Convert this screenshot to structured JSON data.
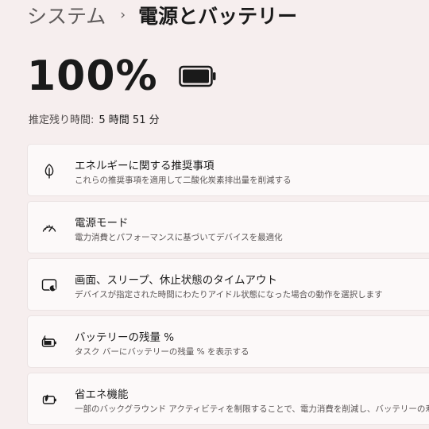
{
  "breadcrumb": {
    "parent": "システム",
    "separator": "›",
    "current": "電源とバッテリー"
  },
  "battery": {
    "percent_text": "100%",
    "charge_level": 1.0,
    "icon": "battery-full-icon",
    "remaining_label": "推定残り時間:",
    "remaining_value": "5 時間 51 分"
  },
  "settings": [
    {
      "icon": "leaf-icon",
      "title": "エネルギーに関する推奨事項",
      "description": "これらの推奨事項を適用して二酸化炭素排出量を削減する"
    },
    {
      "icon": "gauge-icon",
      "title": "電源モード",
      "description": "電力消費とパフォーマンスに基づいてデバイスを最適化"
    },
    {
      "icon": "screen-sleep-icon",
      "title": "画面、スリープ、休止状態のタイムアウト",
      "description": "デバイスが指定された時間にわたりアイドル状態になった場合の動作を選択します"
    },
    {
      "icon": "battery-charging-icon",
      "title": "バッテリーの残量 %",
      "description": "タスク バーにバッテリーの残量 % を表示する"
    },
    {
      "icon": "battery-saver-icon",
      "title": "省エネ機能",
      "description": "一部のバックグラウンド アクティビティを制限することで、電力消費を削減し、バッテリーの寿命を延"
    }
  ],
  "colors": {
    "background": "#f6eeee",
    "card": "#fcf9f9",
    "text": "#1a1a1a",
    "secondary_text": "#5a5555"
  }
}
